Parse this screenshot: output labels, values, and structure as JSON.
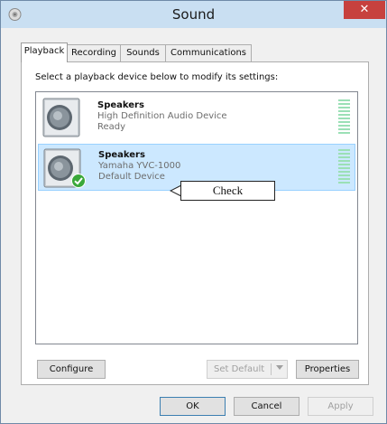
{
  "window": {
    "title": "Sound",
    "close_label": "✕"
  },
  "tabs": [
    {
      "label": "Playback",
      "active": true
    },
    {
      "label": "Recording",
      "active": false
    },
    {
      "label": "Sounds",
      "active": false
    },
    {
      "label": "Communications",
      "active": false
    }
  ],
  "instruction": "Select a playback device below to modify its settings:",
  "devices": [
    {
      "name": "Speakers",
      "description": "High Definition Audio Device",
      "status": "Ready",
      "selected": false,
      "is_default": false
    },
    {
      "name": "Speakers",
      "description": "Yamaha YVC-1000",
      "status": "Default Device",
      "selected": true,
      "is_default": true
    }
  ],
  "callout": {
    "text": "Check"
  },
  "buttons": {
    "configure": "Configure",
    "set_default": "Set Default",
    "properties": "Properties",
    "ok": "OK",
    "cancel": "Cancel",
    "apply": "Apply"
  },
  "icons": {
    "app": "sound-icon",
    "device": "speaker-icon",
    "default_badge": "green-check-icon",
    "dropdown": "chevron-down-icon"
  },
  "colors": {
    "titlebar": "#c9dff2",
    "close": "#c7413e",
    "selection": "#cce8ff",
    "selection_border": "#99d1ff",
    "meter": "#9be0b6",
    "check_badge": "#3aa83a"
  }
}
